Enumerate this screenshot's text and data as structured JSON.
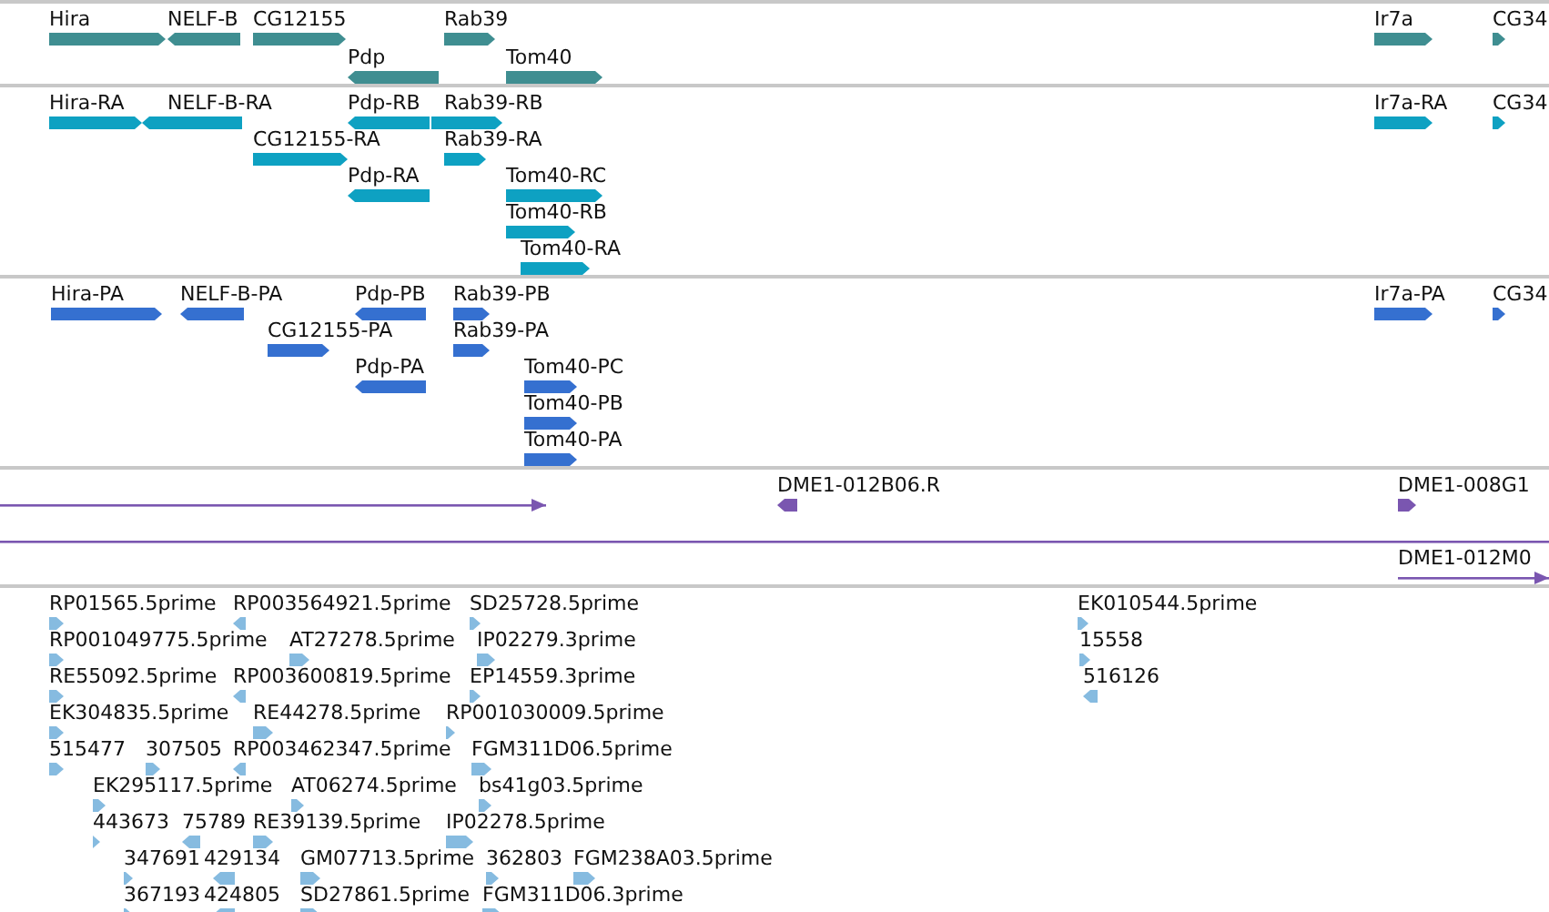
{
  "tracks": [
    {
      "color": "#3f8e91",
      "features": [
        {
          "label": "Hira",
          "reverse": false
        },
        {
          "label": "NELF-B",
          "reverse": true
        },
        {
          "label": "CG12155",
          "reverse": false
        },
        {
          "label": "Rab39",
          "reverse": false
        },
        {
          "label": "Pdp",
          "reverse": true
        },
        {
          "label": "Tom40",
          "reverse": false
        },
        {
          "label": "Ir7a",
          "reverse": false
        },
        {
          "label": "CG34",
          "reverse": false
        }
      ]
    },
    {
      "color": "#0ea1c2",
      "features": [
        {
          "label": "Hira-RA",
          "reverse": false
        },
        {
          "label": "NELF-B-RA",
          "reverse": true
        },
        {
          "label": "Pdp-RB",
          "reverse": true
        },
        {
          "label": "Rab39-RB",
          "reverse": false
        },
        {
          "label": "CG12155-RA",
          "reverse": false
        },
        {
          "label": "Rab39-RA",
          "reverse": false
        },
        {
          "label": "Pdp-RA",
          "reverse": true
        },
        {
          "label": "Tom40-RC",
          "reverse": false
        },
        {
          "label": "Tom40-RB",
          "reverse": false
        },
        {
          "label": "Tom40-RA",
          "reverse": false
        },
        {
          "label": "Ir7a-RA",
          "reverse": false
        },
        {
          "label": "CG34",
          "reverse": false
        }
      ]
    },
    {
      "color": "#3570d0",
      "features": [
        {
          "label": "Hira-PA",
          "reverse": false
        },
        {
          "label": "NELF-B-PA",
          "reverse": true
        },
        {
          "label": "Pdp-PB",
          "reverse": true
        },
        {
          "label": "Rab39-PB",
          "reverse": false
        },
        {
          "label": "CG12155-PA",
          "reverse": false
        },
        {
          "label": "Rab39-PA",
          "reverse": false
        },
        {
          "label": "Pdp-PA",
          "reverse": true
        },
        {
          "label": "Tom40-PC",
          "reverse": false
        },
        {
          "label": "Tom40-PB",
          "reverse": false
        },
        {
          "label": "Tom40-PA",
          "reverse": false
        },
        {
          "label": "Ir7a-PA",
          "reverse": false
        },
        {
          "label": "CG34",
          "reverse": false
        }
      ]
    },
    {
      "color": "#7a56b0",
      "features": [
        {
          "kind": "line",
          "arrow": true,
          "reverse": false
        },
        {
          "kind": "block",
          "label": "DME1-012B06.R",
          "reverse": true
        },
        {
          "kind": "block",
          "label": "DME1-008G1",
          "reverse": false
        },
        {
          "kind": "line",
          "arrow": false
        },
        {
          "kind": "line",
          "arrow": true,
          "label": "DME1-012M0",
          "reverse": false
        }
      ]
    },
    {
      "color": "#86bbe0",
      "features": [
        {
          "label": "RP01565.5prime",
          "reverse": false
        },
        {
          "label": "RP003564921.5prime",
          "reverse": true
        },
        {
          "label": "SD25728.5prime",
          "reverse": false
        },
        {
          "label": "EK010544.5prime",
          "reverse": false
        },
        {
          "label": "RP001049775.5prime",
          "reverse": false
        },
        {
          "label": "AT27278.5prime",
          "reverse": false
        },
        {
          "label": "IP02279.3prime",
          "reverse": false
        },
        {
          "label": "15558",
          "reverse": false
        },
        {
          "label": "RE55092.5prime",
          "reverse": false
        },
        {
          "label": "RP003600819.5prime",
          "reverse": true
        },
        {
          "label": "EP14559.3prime",
          "reverse": false
        },
        {
          "label": "516126",
          "reverse": true
        },
        {
          "label": "EK304835.5prime",
          "reverse": false
        },
        {
          "label": "RE44278.5prime",
          "reverse": false
        },
        {
          "label": "RP001030009.5prime",
          "reverse": false
        },
        {
          "label": "515477",
          "reverse": false
        },
        {
          "label": "307505",
          "reverse": false
        },
        {
          "label": "RP003462347.5prime",
          "reverse": true
        },
        {
          "label": "FGM311D06.5prime",
          "reverse": false
        },
        {
          "label": "EK295117.5prime",
          "reverse": false
        },
        {
          "label": "AT06274.5prime",
          "reverse": false
        },
        {
          "label": "bs41g03.5prime",
          "reverse": false
        },
        {
          "label": "443673",
          "reverse": false
        },
        {
          "label": "75789",
          "reverse": true
        },
        {
          "label": "RE39139.5prime",
          "reverse": false
        },
        {
          "label": "IP02278.5prime",
          "reverse": false
        },
        {
          "label": "347691",
          "reverse": false
        },
        {
          "label": "429134",
          "reverse": true
        },
        {
          "label": "GM07713.5prime",
          "reverse": false
        },
        {
          "label": "362803",
          "reverse": false
        },
        {
          "label": "FGM238A03.5prime",
          "reverse": false
        },
        {
          "label": "367193",
          "reverse": false
        },
        {
          "label": "424805",
          "reverse": true
        },
        {
          "label": "SD27861.5prime",
          "reverse": false
        },
        {
          "label": "FGM311D06.3prime",
          "reverse": false
        }
      ]
    }
  ]
}
